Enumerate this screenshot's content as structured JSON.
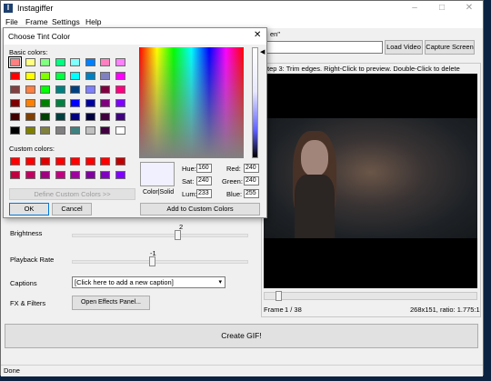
{
  "app": {
    "title": "Instagiffer",
    "icon_letter": "I"
  },
  "window_buttons": [
    "–",
    "□",
    "✕"
  ],
  "menu": [
    "File",
    "Frame",
    "Settings",
    "Help"
  ],
  "url_section": {
    "label_fragment": "en\"",
    "load_button": "Load Video",
    "capture_button": "Capture Screen"
  },
  "step3_label": "tep 3: Trim edges. Right-Click to preview. Double-Click to delete",
  "brightness": {
    "label": "Brightness",
    "value": "2",
    "position": 0.5
  },
  "playback": {
    "label": "Playback Rate",
    "value": "-1",
    "position": 0.45
  },
  "captions": {
    "label": "Captions",
    "selected": "[Click here to add a new caption]"
  },
  "fx": {
    "label": "FX & Filters",
    "button": "Open Effects Panel..."
  },
  "frame_info": {
    "frame_label": "Frame",
    "frame_value": "1 / 38",
    "dims": "268x151, ratio: 1.775:1"
  },
  "create_button": "Create GIF!",
  "status": "Done",
  "dialog": {
    "title": "Choose Tint Color",
    "basic_colors_label": "Basic colors:",
    "custom_colors_label": "Custom colors:",
    "define_button": "Define Custom Colors >>",
    "ok_button": "OK",
    "cancel_button": "Cancel",
    "color_solid_label": "Color|Solid",
    "add_custom_button": "Add to Custom Colors",
    "hue": {
      "label": "Hue:",
      "value": "160"
    },
    "sat": {
      "label": "Sat:",
      "value": "240"
    },
    "lum": {
      "label": "Lum:",
      "value": "233"
    },
    "red": {
      "label": "Red:",
      "value": "240"
    },
    "green": {
      "label": "Green:",
      "value": "240"
    },
    "blue": {
      "label": "Blue:",
      "value": "255"
    },
    "preview_color": "#f0f0ff",
    "basic_colors": [
      "#ff8080",
      "#ffff80",
      "#80ff80",
      "#00ff80",
      "#80ffff",
      "#0080ff",
      "#ff80c0",
      "#ff80ff",
      "#ff0000",
      "#ffff00",
      "#80ff00",
      "#00ff40",
      "#00ffff",
      "#0080c0",
      "#8080c0",
      "#ff00ff",
      "#804040",
      "#ff8040",
      "#00ff00",
      "#008080",
      "#004080",
      "#8080ff",
      "#800040",
      "#ff0080",
      "#800000",
      "#ff8000",
      "#008000",
      "#008040",
      "#0000ff",
      "#0000a0",
      "#800080",
      "#8000ff",
      "#400000",
      "#804000",
      "#004000",
      "#004040",
      "#000080",
      "#000040",
      "#400040",
      "#400080",
      "#000000",
      "#808000",
      "#808040",
      "#808080",
      "#408080",
      "#c0c0c0",
      "#400040",
      "#ffffff"
    ],
    "custom_colors": [
      "#ff0000",
      "#ff0000",
      "#e00000",
      "#ff0000",
      "#ff0000",
      "#ff0000",
      "#ff0000",
      "#c00000",
      "#c00040",
      "#c00060",
      "#a00080",
      "#c00080",
      "#a000a0",
      "#8000a0",
      "#8000c0",
      "#8000ff"
    ],
    "selected_basic_index": 0
  }
}
